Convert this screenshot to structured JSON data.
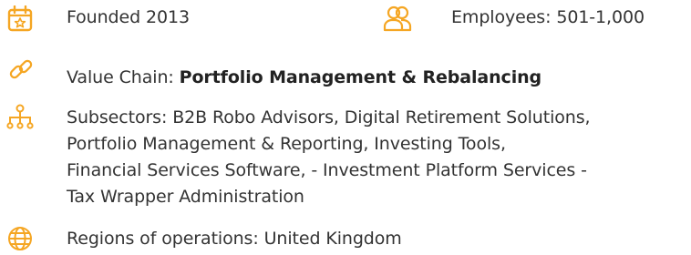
{
  "colors": {
    "accent": "#F5A623",
    "text": "#333333"
  },
  "founded": {
    "icon": "calendar-icon",
    "text": "Founded 2013"
  },
  "employees": {
    "icon": "people-icon",
    "text": "Employees: 501-1,000"
  },
  "value_chain": {
    "icon": "link-icon",
    "label": "Value Chain: ",
    "value": "Portfolio Management & Rebalancing"
  },
  "subsectors": {
    "icon": "hierarchy-icon",
    "lines": [
      "Subsectors: B2B Robo Advisors, Digital Retirement Solutions,",
      "Portfolio Management & Reporting, Investing Tools,",
      "Financial Services Software, - Investment Platform Services -",
      "Tax Wrapper Administration"
    ]
  },
  "regions": {
    "icon": "globe-icon",
    "text": "Regions of operations: United Kingdom"
  }
}
